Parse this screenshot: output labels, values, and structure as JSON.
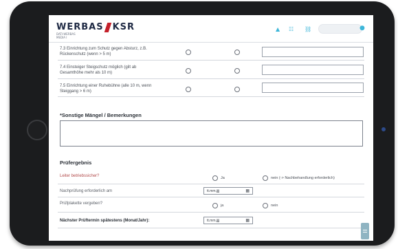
{
  "header": {
    "logo_left": "WERBAS",
    "logo_right": "KSR",
    "logo_sub_1": "DATI-WERBAS",
    "logo_sub_2": "MEDIA I"
  },
  "questions": [
    {
      "text_1": "7.3 Einrichtung zum Schutz gegen Absturz, z.B.",
      "text_2": "Rückenschutz (wenn > 5 m)"
    },
    {
      "text_1": "7.4 Einsteiger Steigschutz möglich (gilt ab",
      "text_2": "Gesamthöhe mehr als 10 m)"
    },
    {
      "text_1": "7.5 Einrichtung einer Ruhebühne (alle 10 m, wenn",
      "text_2": "Steiggang > 6 m)"
    }
  ],
  "remarks": {
    "title": "*Sonstige Mängel / Bemerkungen",
    "value": ""
  },
  "result": {
    "title": "Prüfergebnis",
    "q1_label": "Leiter betriebssicher?",
    "q1_yes": "Ja",
    "q1_no": "nein (-> Nachbehandlung erforderlich)",
    "q2_label": "Nachprüfung erforderlich am",
    "q2_value": "tt.mm.jjjj",
    "q3_label": "Prüfplakette vergeben?",
    "q3_yes": "ja",
    "q3_no": "nein",
    "q4_label": "Nächster Prüftermin spätestens (Monat/Jahr):",
    "q4_value": "tt.mm.jjjj"
  },
  "colors": {
    "brand": "#1f2a44",
    "logo_accent": "#c4202a",
    "header_icons": "#3db6d9",
    "label_accent": "#b24a4a"
  }
}
